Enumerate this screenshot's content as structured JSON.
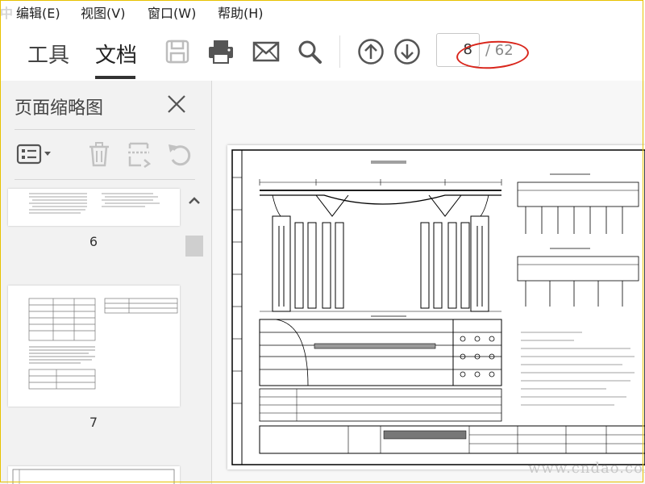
{
  "menu": {
    "watermark": "中",
    "items": [
      "编辑(E)",
      "视图(V)",
      "窗口(W)",
      "帮助(H)"
    ]
  },
  "toolbar": {
    "tabs": [
      "工具",
      "文档"
    ],
    "active_tab": "文档",
    "buttons": [
      "save-icon",
      "print-icon",
      "mail-icon",
      "search-icon",
      "arrow-up-icon",
      "arrow-down-icon"
    ],
    "page_current": "8",
    "page_total": "/ 62"
  },
  "sidebar": {
    "title": "页面缩略图",
    "tools": [
      "options-icon",
      "delete-icon",
      "extract-icon",
      "rotate-icon"
    ],
    "thumbnails": [
      {
        "page": "6"
      },
      {
        "page": "7"
      }
    ]
  },
  "document": {
    "watermark": "www.cndao.com"
  },
  "colors": {
    "annotation": "#d9261c",
    "frame": "#e8c200"
  }
}
